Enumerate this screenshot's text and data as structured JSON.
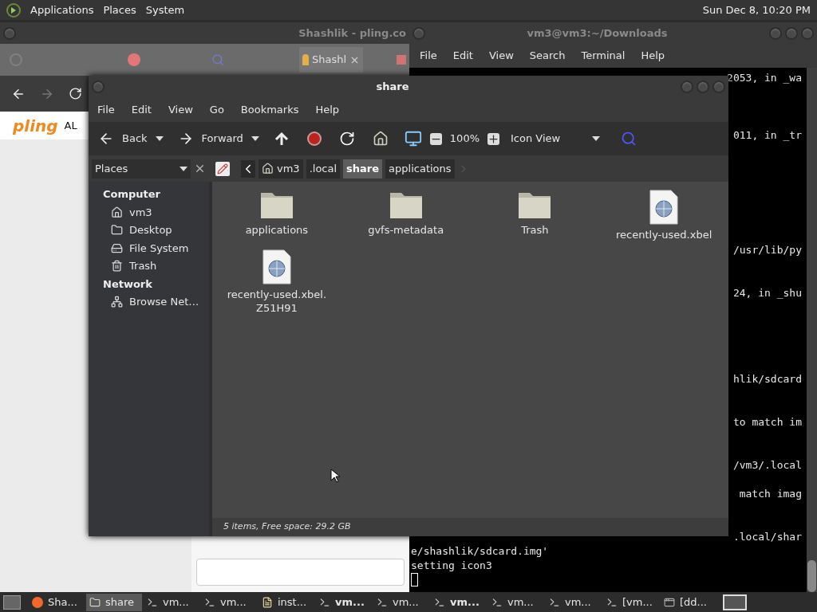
{
  "top_panel": {
    "menus": [
      "Applications",
      "Places",
      "System"
    ],
    "clock": "Sun Dec 8, 10:20 PM"
  },
  "browser": {
    "title": "Shashlik - pling.co",
    "tabs": [
      {
        "label": "Shashl",
        "selected": true
      }
    ],
    "logo": "pling",
    "heading": "AL"
  },
  "terminal": {
    "title": "vm3@vm3:~/Downloads",
    "menus": [
      "File",
      "Edit",
      "View",
      "Search",
      "Terminal",
      "Help"
    ],
    "lines": [
      {
        "text": "2053, in _wa",
        "kind": "partial"
      },
      {
        "text": "011, in _tr",
        "kind": "partial"
      },
      {
        "text": "/usr/lib/py",
        "kind": "partial"
      },
      {
        "text": "24, in _shu",
        "kind": "partial"
      },
      {
        "text": "hlik/sdcard",
        "kind": "partial"
      },
      {
        "text": "to match im",
        "kind": "partial"
      },
      {
        "text": "/vm3/.local",
        "kind": "partial"
      },
      {
        "text": "match imag",
        "kind": "partial"
      },
      {
        "text": ".local/shar",
        "kind": "partial"
      },
      {
        "text": "e/shashlik/sdcard.img'",
        "kind": "full"
      },
      {
        "text": "setting icon3",
        "kind": "full"
      }
    ]
  },
  "file_manager": {
    "title": "share",
    "menus": [
      "File",
      "Edit",
      "View",
      "Go",
      "Bookmarks",
      "Help"
    ],
    "toolbar": {
      "back": "Back",
      "forward": "Forward",
      "zoom": "100%",
      "view": "Icon View"
    },
    "side_pane": "Places",
    "breadcrumbs": [
      {
        "label": "vm3",
        "kind": "home",
        "selected": false
      },
      {
        "label": ".local",
        "kind": "plain",
        "selected": false
      },
      {
        "label": "share",
        "kind": "plain",
        "selected": true
      },
      {
        "label": "applications",
        "kind": "plain",
        "selected": false
      }
    ],
    "sidebar": [
      {
        "heading": "Computer",
        "items": [
          {
            "label": "vm3",
            "kind": "home"
          },
          {
            "label": "Desktop",
            "kind": "desktop"
          },
          {
            "label": "File System",
            "kind": "drive"
          },
          {
            "label": "Trash",
            "kind": "trash"
          }
        ]
      },
      {
        "heading": "Network",
        "items": [
          {
            "label": "Browse Net…",
            "kind": "network"
          }
        ]
      }
    ],
    "files": [
      {
        "name": "applications",
        "kind": "folder"
      },
      {
        "name": "gvfs-metadata",
        "kind": "folder"
      },
      {
        "name": "Trash",
        "kind": "folder"
      },
      {
        "name": "recently-used.xbel",
        "kind": "document"
      },
      {
        "name": "recently-used.xbel.Z51H91",
        "kind": "document"
      }
    ],
    "status": "5 items, Free space: 29.2 GB"
  },
  "taskbar": [
    {
      "label": "Sha...",
      "kind": "browser",
      "selected": false,
      "urgent": false
    },
    {
      "label": "share",
      "kind": "folder",
      "selected": true,
      "urgent": false
    },
    {
      "label": "vm...",
      "kind": "terminal",
      "selected": false,
      "urgent": false
    },
    {
      "label": "vm...",
      "kind": "terminal",
      "selected": false,
      "urgent": false
    },
    {
      "label": "inst...",
      "kind": "editor",
      "selected": false,
      "urgent": false
    },
    {
      "label": "vm...",
      "kind": "terminal",
      "selected": false,
      "urgent": true
    },
    {
      "label": "vm...",
      "kind": "terminal",
      "selected": false,
      "urgent": false
    },
    {
      "label": "vm...",
      "kind": "terminal",
      "selected": false,
      "urgent": true
    },
    {
      "label": "vm...",
      "kind": "terminal",
      "selected": false,
      "urgent": false
    },
    {
      "label": "vm...",
      "kind": "terminal",
      "selected": false,
      "urgent": false
    },
    {
      "label": "[vm...",
      "kind": "terminal",
      "selected": false,
      "urgent": false
    },
    {
      "label": "[dd...",
      "kind": "window",
      "selected": false,
      "urgent": false
    }
  ]
}
